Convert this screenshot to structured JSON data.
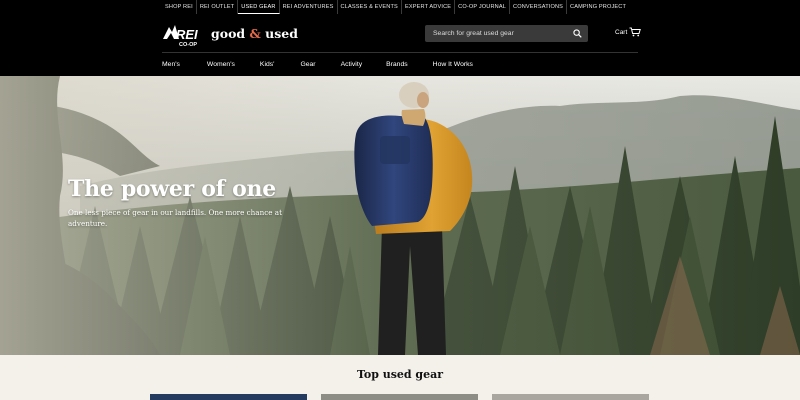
{
  "topnav": {
    "items": [
      "SHOP REI",
      "REI OUTLET",
      "USED GEAR",
      "REI ADVENTURES",
      "CLASSES & EVENTS",
      "EXPERT ADVICE",
      "CO-OP JOURNAL",
      "CONVERSATIONS",
      "CAMPING PROJECT"
    ],
    "active": "USED GEAR"
  },
  "header": {
    "logo_text": "REI",
    "logo_sub": "CO-OP",
    "brand_part1": "good",
    "brand_amp": "&",
    "brand_part2": "used",
    "search_placeholder": "Search for great used gear",
    "cart_label": "Cart"
  },
  "mainnav": {
    "items": [
      "Men's",
      "Women's",
      "Kids'",
      "Gear",
      "Activity",
      "Brands",
      "How It Works"
    ]
  },
  "hero": {
    "title": "The power of one",
    "subtitle": "One less piece of gear in our landfills. One more chance at adventure."
  },
  "section": {
    "title": "Top used gear"
  },
  "colors": {
    "nav_background": "#000000",
    "brand_accent": "#e86b4a",
    "page_background": "#f4f1eb",
    "jacket": "#d69a2c",
    "backpack": "#283a6b"
  }
}
